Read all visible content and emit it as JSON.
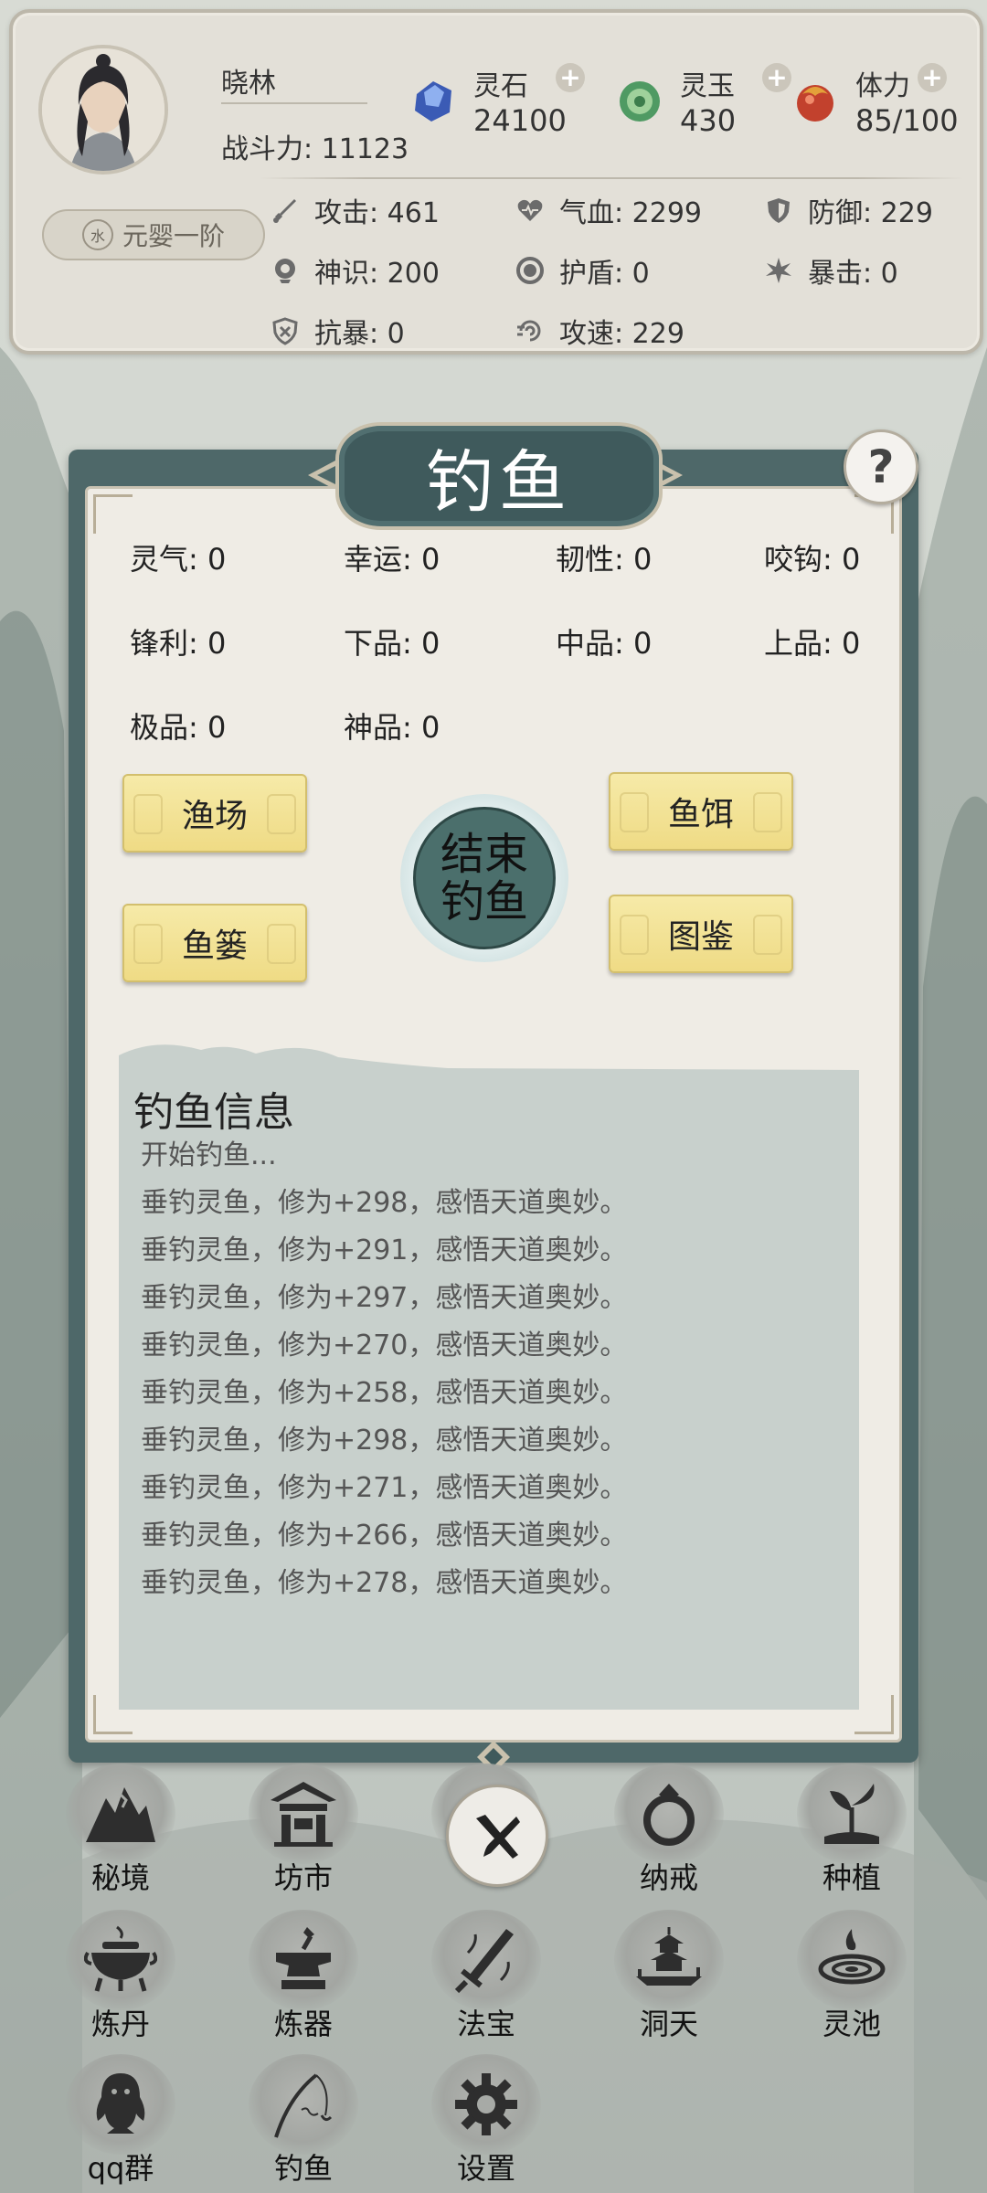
{
  "player": {
    "name": "晓林",
    "power_label": "战斗力: 11123",
    "realm": "元婴一阶",
    "realm_glyph": "水"
  },
  "resources": [
    {
      "label": "灵石",
      "value": "24100",
      "icon": "blue-crystal-icon",
      "color": "#3b5bb5"
    },
    {
      "label": "灵玉",
      "value": "430",
      "icon": "jade-disc-icon",
      "color": "#4f9a63"
    },
    {
      "label": "体力",
      "value": "85/100",
      "icon": "stamina-orb-icon",
      "color": "#c2412d"
    }
  ],
  "plus_symbol": "+",
  "stats": {
    "attack": "攻击: 461",
    "hp": "气血: 2299",
    "defense": "防御: 229",
    "sense": "神识: 200",
    "shield": "护盾: 0",
    "crit": "暴击: 0",
    "crit_resist": "抗暴: 0",
    "speed": "攻速: 229"
  },
  "panel": {
    "title": "钓鱼",
    "help": "?",
    "attrs": [
      "灵气: 0",
      "幸运: 0",
      "韧性: 0",
      "咬钩: 0",
      "锋利: 0",
      "下品: 0",
      "中品: 0",
      "上品: 0",
      "极品: 0",
      "神品: 0"
    ],
    "buttons": {
      "fishing_ground": "渔场",
      "bait": "鱼饵",
      "creel": "鱼篓",
      "catalog": "图鉴",
      "end_line1": "结束",
      "end_line2": "钓鱼"
    },
    "log": {
      "title": "钓鱼信息",
      "lines": [
        "开始钓鱼...",
        "垂钓灵鱼，修为+298，感悟天道奥妙。",
        "垂钓灵鱼，修为+291，感悟天道奥妙。",
        "垂钓灵鱼，修为+297，感悟天道奥妙。",
        "垂钓灵鱼，修为+270，感悟天道奥妙。",
        "垂钓灵鱼，修为+258，感悟天道奥妙。",
        "垂钓灵鱼，修为+298，感悟天道奥妙。",
        "垂钓灵鱼，修为+271，感悟天道奥妙。",
        "垂钓灵鱼，修为+266，感悟天道奥妙。",
        "垂钓灵鱼，修为+278，感悟天道奥妙。"
      ]
    }
  },
  "menu": [
    {
      "label": "秘境",
      "icon": "mountain-realm-icon"
    },
    {
      "label": "坊市",
      "icon": "market-pavilion-icon"
    },
    {
      "label": "纳戒",
      "icon": "storage-ring-icon"
    },
    {
      "label": "种植",
      "icon": "plant-sprout-icon"
    },
    {
      "label": "炼丹",
      "icon": "alchemy-cauldron-icon"
    },
    {
      "label": "炼器",
      "icon": "forge-anvil-icon"
    },
    {
      "label": "法宝",
      "icon": "magic-sword-icon"
    },
    {
      "label": "洞天",
      "icon": "floating-palace-icon"
    },
    {
      "label": "灵池",
      "icon": "spirit-pool-icon"
    },
    {
      "label": "qq群",
      "icon": "qq-penguin-icon"
    },
    {
      "label": "钓鱼",
      "icon": "fishing-rod-icon"
    },
    {
      "label": "设置",
      "icon": "gear-icon"
    }
  ]
}
